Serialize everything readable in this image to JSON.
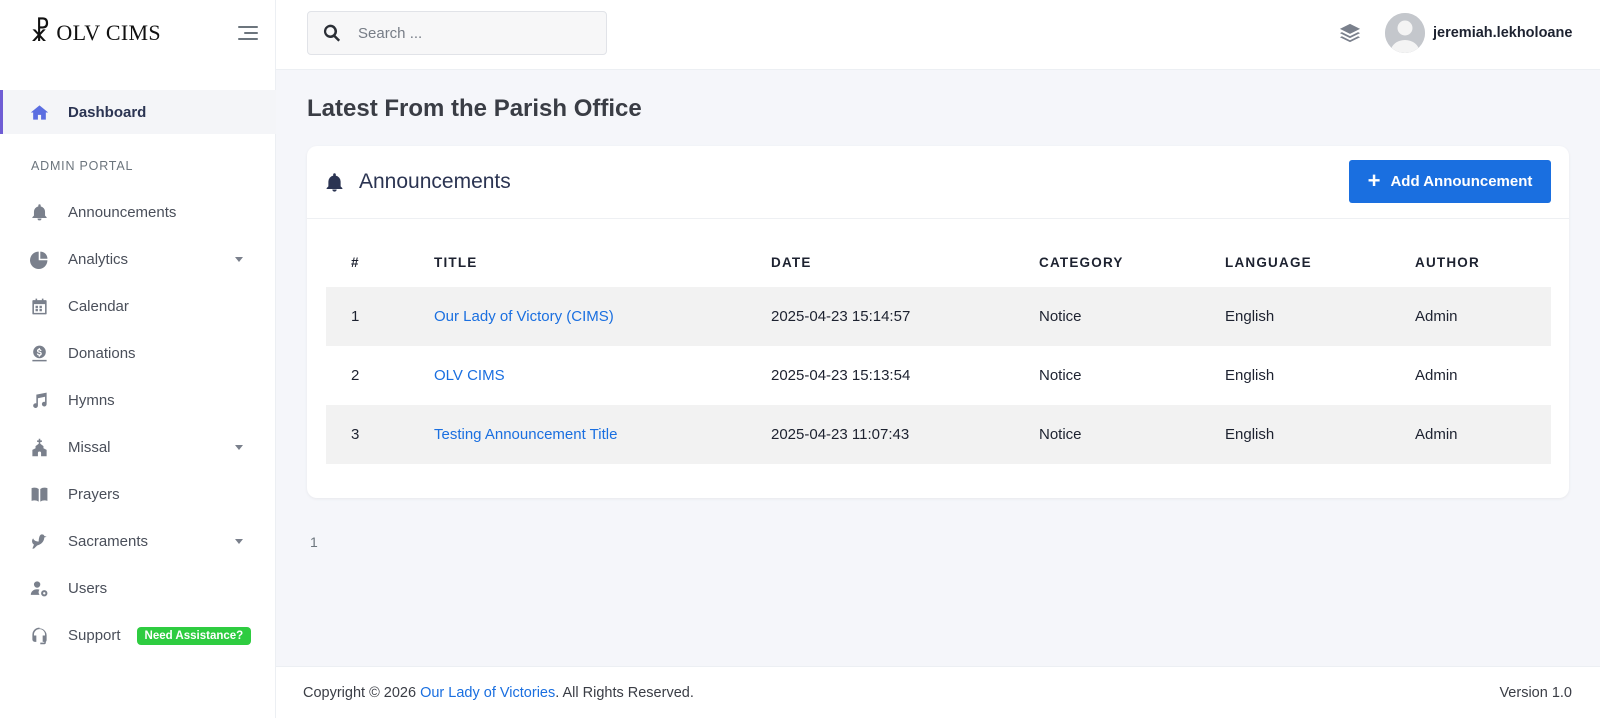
{
  "brand": {
    "mark": "☧",
    "name": "OLV CIMS"
  },
  "sidebar": {
    "dashboard": {
      "label": "Dashboard",
      "icon": "home-icon"
    },
    "section_label": "ADMIN PORTAL",
    "items": [
      {
        "label": "Announcements",
        "icon": "bell-icon"
      },
      {
        "label": "Analytics",
        "icon": "pie-chart-icon"
      },
      {
        "label": "Calendar",
        "icon": "calendar-icon"
      },
      {
        "label": "Donations",
        "icon": "money-icon"
      },
      {
        "label": "Hymns",
        "icon": "music-icon"
      },
      {
        "label": "Missal",
        "icon": "church-icon"
      },
      {
        "label": "Prayers",
        "icon": "book-icon"
      },
      {
        "label": "Sacraments",
        "icon": "dove-icon"
      },
      {
        "label": "Users",
        "icon": "user-gear-icon"
      },
      {
        "label": "Support",
        "icon": "headset-icon",
        "badge": "Need Assistance?"
      }
    ]
  },
  "topbar": {
    "search_placeholder": "Search ...",
    "username": "jeremiah.lekholoane"
  },
  "main": {
    "page_title": "Latest From the Parish Office",
    "card_title": "Announcements",
    "add_button_label": "Add Announcement",
    "table": {
      "headers": [
        "#",
        "TITLE",
        "DATE",
        "CATEGORY",
        "LANGUAGE",
        "AUTHOR"
      ],
      "rows": [
        {
          "num": "1",
          "title": "Our Lady of Victory (CIMS)",
          "date": "2025-04-23 15:14:57",
          "category": "Notice",
          "language": "English",
          "author": "Admin"
        },
        {
          "num": "2",
          "title": "OLV CIMS",
          "date": "2025-04-23 15:13:54",
          "category": "Notice",
          "language": "English",
          "author": "Admin"
        },
        {
          "num": "3",
          "title": "Testing Announcement Title",
          "date": "2025-04-23 11:07:43",
          "category": "Notice",
          "language": "English",
          "author": "Admin"
        }
      ]
    },
    "pagination_page": "1"
  },
  "footer": {
    "copyright_prefix": "Copyright © 2026 ",
    "org_link": "Our Lady of Victories",
    "copyright_suffix": ". All Rights Reserved.",
    "version": "Version 1.0"
  },
  "colors": {
    "accent": "#1a6fe0",
    "active_border": "#6f5dd4",
    "badge": "#2ecc40",
    "sidebar_bg": "#ffffff",
    "page_bg": "#f5f6fa"
  }
}
